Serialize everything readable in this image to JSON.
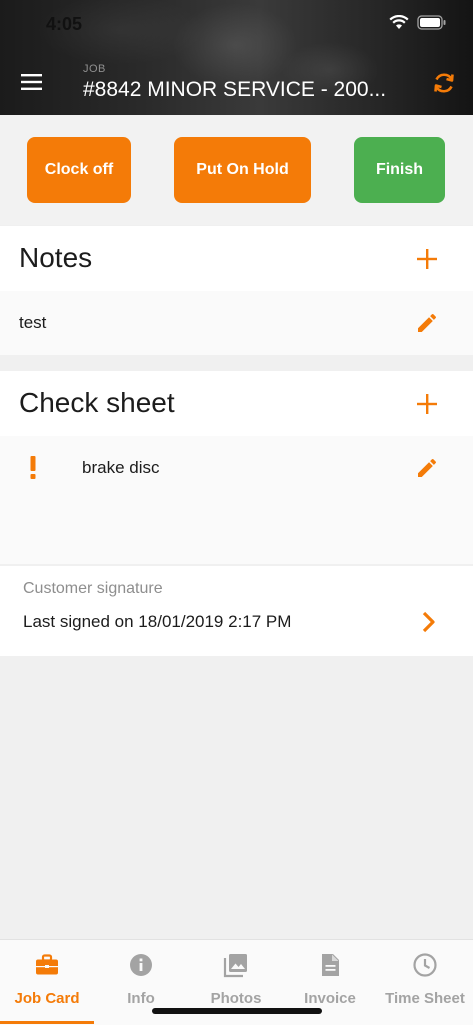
{
  "status_bar": {
    "time": "4:05"
  },
  "header": {
    "label": "JOB",
    "title": "#8842 MINOR SERVICE - 200..."
  },
  "actions": {
    "clock_off": "Clock off",
    "put_on_hold": "Put On Hold",
    "finish": "Finish"
  },
  "notes": {
    "title": "Notes",
    "items": [
      {
        "text": "test"
      }
    ]
  },
  "check_sheet": {
    "title": "Check sheet",
    "items": [
      {
        "text": "brake disc",
        "status": "warning"
      }
    ]
  },
  "signature": {
    "label": "Customer signature",
    "value": "Last signed on 18/01/2019 2:17 PM"
  },
  "tabs": [
    {
      "label": "Job Card",
      "icon": "briefcase-icon",
      "active": true
    },
    {
      "label": "Info",
      "icon": "info-icon",
      "active": false
    },
    {
      "label": "Photos",
      "icon": "photos-icon",
      "active": false
    },
    {
      "label": "Invoice",
      "icon": "document-icon",
      "active": false
    },
    {
      "label": "Time Sheet",
      "icon": "clock-icon",
      "active": false
    }
  ],
  "colors": {
    "accent": "#f47b08",
    "finish": "#4caf50",
    "inactive_tab": "#a3a3a3"
  }
}
